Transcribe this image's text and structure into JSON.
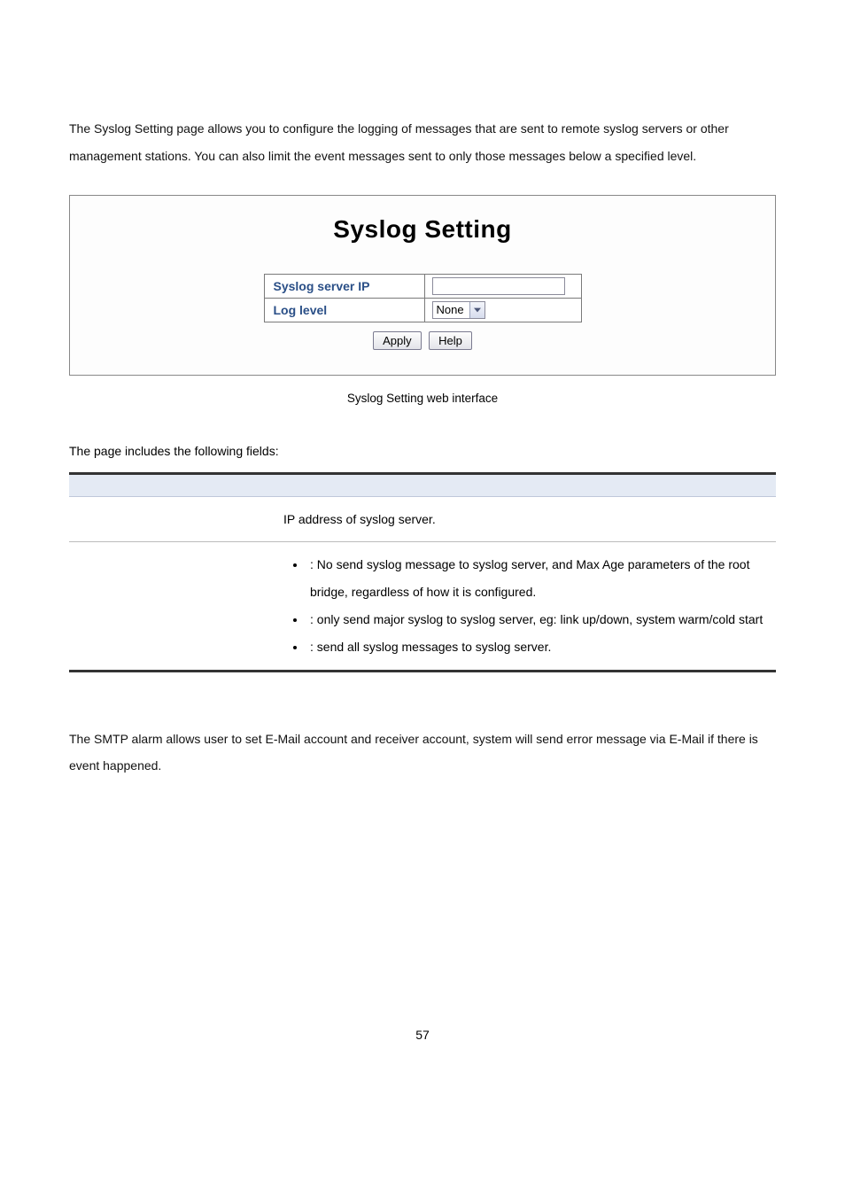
{
  "intro1": "The Syslog Setting page allows you to configure the logging of messages that are sent to remote syslog servers or other management stations. You can also limit the event messages sent to only those messages below a specified level.",
  "figure": {
    "title": "Syslog Setting",
    "row1_label": "Syslog server IP",
    "row1_value": "",
    "row2_label": "Log level",
    "row2_select": "None",
    "apply_label": "Apply",
    "help_label": "Help"
  },
  "caption": "Syslog Setting web interface",
  "fields_intro": "The page includes the following fields:",
  "table": {
    "row1_desc": "IP address of syslog server.",
    "row2_b1": ": No send syslog message to syslog server, and Max Age parameters of the root bridge, regardless of how it is configured.",
    "row2_b2": ": only send major syslog to syslog server, eg: link up/down, system warm/cold start",
    "row2_b3": ": send all syslog messages to syslog server."
  },
  "intro2": "The SMTP alarm allows user to set E-Mail account and receiver account, system will send error message via E-Mail if there is event happened.",
  "page_number": "57"
}
